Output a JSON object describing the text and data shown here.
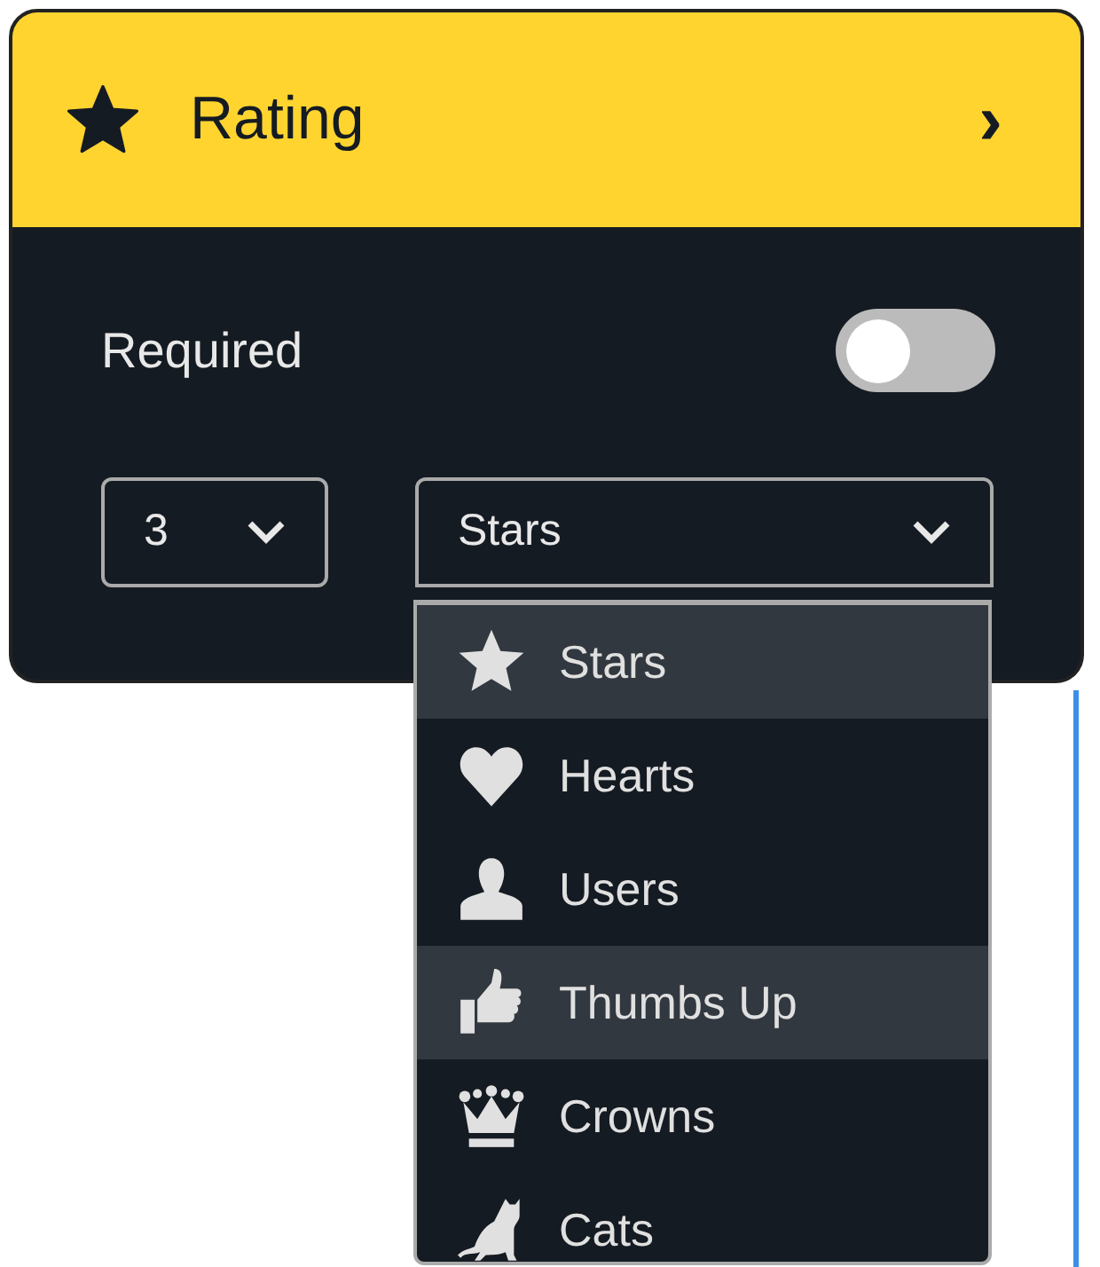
{
  "header": {
    "title": "Rating",
    "chevron": "›"
  },
  "required": {
    "label": "Required",
    "on": false
  },
  "count_select": {
    "value": "3"
  },
  "type_select": {
    "value": "Stars",
    "expanded": true,
    "options": [
      {
        "label": "Stars",
        "kind": "star",
        "highlighted": true
      },
      {
        "label": "Hearts",
        "kind": "heart",
        "highlighted": false
      },
      {
        "label": "Users",
        "kind": "user",
        "highlighted": false
      },
      {
        "label": "Thumbs Up",
        "kind": "thumb",
        "highlighted": true
      },
      {
        "label": "Crowns",
        "kind": "crown",
        "highlighted": false
      },
      {
        "label": "Cats",
        "kind": "cat",
        "highlighted": false
      }
    ]
  }
}
